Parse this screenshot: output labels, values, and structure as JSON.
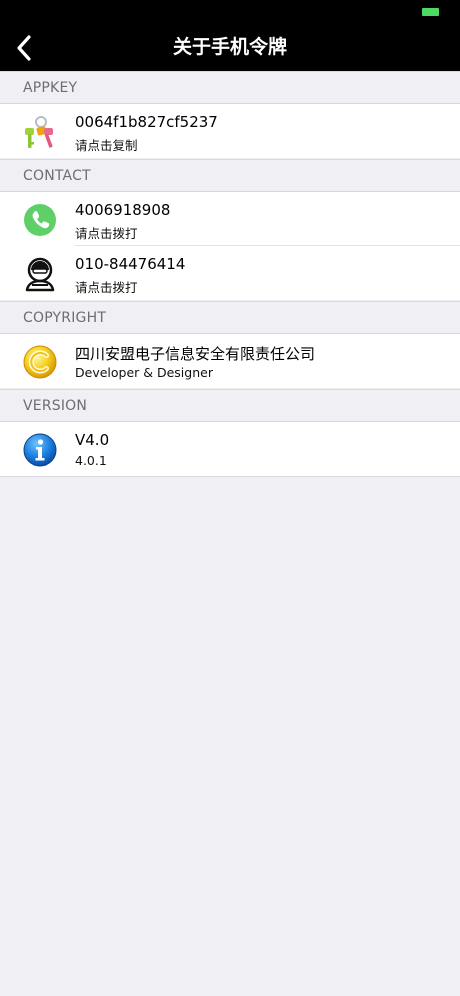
{
  "nav": {
    "title": "关于手机令牌"
  },
  "sections": [
    {
      "header": "APPKEY",
      "rows": [
        {
          "title": "0064f1b827cf5237",
          "subtitle": "请点击复制",
          "icon": "keys-icon"
        }
      ]
    },
    {
      "header": "CONTACT",
      "rows": [
        {
          "title": "4006918908",
          "subtitle": "请点击拨打",
          "icon": "phone-icon"
        },
        {
          "title": "010-84476414",
          "subtitle": "请点击拨打",
          "icon": "headset-icon"
        }
      ]
    },
    {
      "header": "COPYRIGHT",
      "rows": [
        {
          "title": "四川安盟电子信息安全有限责任公司",
          "subtitle": "Developer & Designer",
          "icon": "copyright-icon"
        }
      ]
    },
    {
      "header": "VERSION",
      "rows": [
        {
          "title": "V4.0",
          "subtitle": "4.0.1",
          "icon": "info-icon"
        }
      ]
    }
  ],
  "colors": {
    "nav_background": "#000000",
    "page_background": "#efeff4",
    "battery": "#4cd964",
    "phone_green": "#5fd068"
  }
}
